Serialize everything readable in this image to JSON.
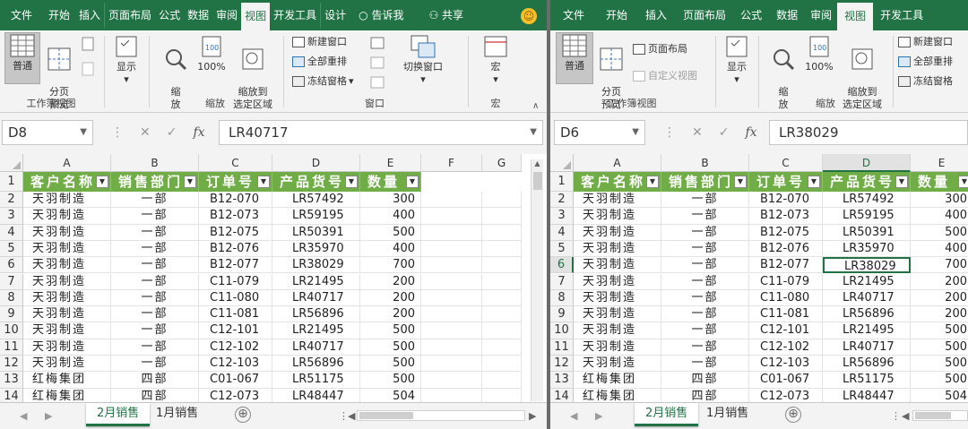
{
  "left": {
    "menu": [
      "文件",
      "开始",
      "插入",
      "页面布局",
      "公式",
      "数据",
      "审阅",
      "视图",
      "开发工具",
      "设计",
      "告诉我",
      "共享"
    ],
    "active_menu": "视图",
    "ribbon": {
      "normal": "普通",
      "page_break": "分页\n预览",
      "show": "显示",
      "zoom": "缩\n放",
      "zoom100": "100%",
      "zoom_sel": "缩放到\n选定区域",
      "new_window": "新建窗口",
      "arrange_all": "全部重排",
      "freeze": "冻结窗格",
      "switch": "切换窗口",
      "macro": "宏",
      "g_views": "工作簿视图",
      "g_zoom": "缩放",
      "g_window": "窗口",
      "g_macro": "宏"
    },
    "namebox": "D8",
    "formula": "LR40717",
    "cols": [
      "A",
      "B",
      "C",
      "D",
      "E",
      "F",
      "G"
    ],
    "headers": [
      "客户名称",
      "销售部门",
      "订单号",
      "产品货号",
      "数量"
    ],
    "rows": [
      [
        "天羽制造",
        "一部",
        "B12-070",
        "LR57492",
        "300"
      ],
      [
        "天羽制造",
        "一部",
        "B12-073",
        "LR59195",
        "400"
      ],
      [
        "天羽制造",
        "一部",
        "B12-075",
        "LR50391",
        "500"
      ],
      [
        "天羽制造",
        "一部",
        "B12-076",
        "LR35970",
        "400"
      ],
      [
        "天羽制造",
        "一部",
        "B12-077",
        "LR38029",
        "700"
      ],
      [
        "天羽制造",
        "一部",
        "C11-079",
        "LR21495",
        "200"
      ],
      [
        "天羽制造",
        "一部",
        "C11-080",
        "LR40717",
        "200"
      ],
      [
        "天羽制造",
        "一部",
        "C11-081",
        "LR56896",
        "200"
      ],
      [
        "天羽制造",
        "一部",
        "C12-101",
        "LR21495",
        "500"
      ],
      [
        "天羽制造",
        "一部",
        "C12-102",
        "LR40717",
        "500"
      ],
      [
        "天羽制造",
        "一部",
        "C12-103",
        "LR56896",
        "500"
      ],
      [
        "红梅集团",
        "四部",
        "C01-067",
        "LR51175",
        "500"
      ],
      [
        "红梅集团",
        "四部",
        "C12-073",
        "LR48447",
        "504"
      ]
    ],
    "tabs": [
      "2月销售",
      "1月销售"
    ],
    "add_symbol": "⊕"
  },
  "right": {
    "menu": [
      "文件",
      "开始",
      "插入",
      "页面布局",
      "公式",
      "数据",
      "审阅",
      "视图",
      "开发工具"
    ],
    "active_menu": "视图",
    "ribbon": {
      "normal": "普通",
      "page_break": "分页\n预览",
      "page_layout": "页面布局",
      "custom_view": "自定义视图",
      "show": "显示",
      "zoom": "缩\n放",
      "zoom100": "100%",
      "zoom_sel": "缩放到\n选定区域",
      "new_window": "新建窗口",
      "arrange_all": "全部重排",
      "freeze": "冻结窗格",
      "g_views": "工作簿视图",
      "g_zoom": "缩放"
    },
    "namebox": "D6",
    "formula": "LR38029",
    "cols": [
      "A",
      "B",
      "C",
      "D",
      "E"
    ],
    "tabs": [
      "2月销售",
      "1月销售"
    ],
    "add_symbol": "⊕"
  },
  "colors": {
    "excel_green": "#217346",
    "header_green": "#70ad47"
  }
}
